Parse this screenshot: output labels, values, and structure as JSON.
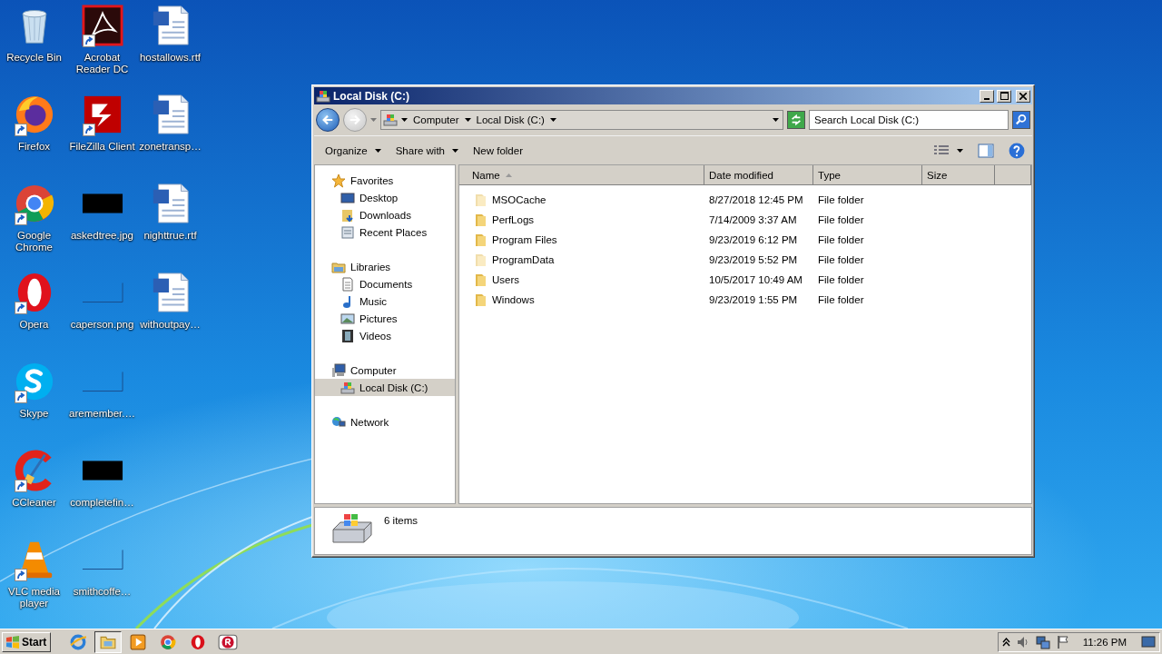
{
  "desktop_icons": [
    {
      "label": "Recycle Bin",
      "kind": "recycle-bin",
      "shortcut": false
    },
    {
      "label": "Firefox",
      "kind": "firefox",
      "shortcut": true
    },
    {
      "label": "Google Chrome",
      "kind": "chrome",
      "shortcut": true
    },
    {
      "label": "Opera",
      "kind": "opera",
      "shortcut": true
    },
    {
      "label": "Skype",
      "kind": "skype",
      "shortcut": true
    },
    {
      "label": "CCleaner",
      "kind": "ccleaner",
      "shortcut": true
    },
    {
      "label": "VLC media player",
      "kind": "vlc",
      "shortcut": true
    },
    {
      "label": "Acrobat Reader DC",
      "kind": "acrobat",
      "shortcut": true
    },
    {
      "label": "FileZilla Client",
      "kind": "filezilla",
      "shortcut": true
    },
    {
      "label": "askedtree.jpg",
      "kind": "image-black",
      "shortcut": false
    },
    {
      "label": "caperson.png",
      "kind": "image-blank",
      "shortcut": false
    },
    {
      "label": "aremember.…",
      "kind": "image-blank",
      "shortcut": false
    },
    {
      "label": "completefin…",
      "kind": "image-black",
      "shortcut": false
    },
    {
      "label": "smithcoffe…",
      "kind": "image-blank",
      "shortcut": false
    },
    {
      "label": "hostallows.rtf",
      "kind": "word-doc",
      "shortcut": false
    },
    {
      "label": "zonetransp…",
      "kind": "word-doc",
      "shortcut": false
    },
    {
      "label": "nighttrue.rtf",
      "kind": "word-doc",
      "shortcut": false
    },
    {
      "label": "withoutpay…",
      "kind": "word-doc",
      "shortcut": false
    }
  ],
  "window": {
    "title": "Local Disk (C:)",
    "breadcrumb": [
      "Computer",
      "Local Disk (C:)"
    ],
    "search": {
      "placeholder": "Search Local Disk (C:)"
    },
    "toolbar": [
      {
        "label": "Organize",
        "dropdown": true
      },
      {
        "label": "Share with",
        "dropdown": true
      },
      {
        "label": "New folder",
        "dropdown": false
      }
    ],
    "nav": [
      {
        "label": "Favorites",
        "kind": "favorites",
        "selected": false,
        "children": [
          {
            "label": "Desktop",
            "kind": "desktop",
            "selected": false
          },
          {
            "label": "Downloads",
            "kind": "downloads",
            "selected": false
          },
          {
            "label": "Recent Places",
            "kind": "recent",
            "selected": false
          }
        ]
      },
      {
        "label": "Libraries",
        "kind": "libraries",
        "selected": false,
        "children": [
          {
            "label": "Documents",
            "kind": "documents",
            "selected": false
          },
          {
            "label": "Music",
            "kind": "music",
            "selected": false
          },
          {
            "label": "Pictures",
            "kind": "pictures",
            "selected": false
          },
          {
            "label": "Videos",
            "kind": "videos",
            "selected": false
          }
        ]
      },
      {
        "label": "Computer",
        "kind": "computer",
        "selected": false,
        "children": [
          {
            "label": "Local Disk (C:)",
            "kind": "drive",
            "selected": true
          }
        ]
      },
      {
        "label": "Network",
        "kind": "network",
        "selected": false
      }
    ],
    "table": {
      "columns": [
        {
          "label": "Name",
          "sorted": true
        },
        {
          "label": "Date modified",
          "sorted": false
        },
        {
          "label": "Type",
          "sorted": false
        },
        {
          "label": "Size",
          "sorted": false
        }
      ],
      "rows": [
        {
          "name": "MSOCache",
          "date": "8/27/2018 12:45 PM",
          "type": "File folder",
          "hidden": true
        },
        {
          "name": "PerfLogs",
          "date": "7/14/2009 3:37 AM",
          "type": "File folder",
          "hidden": false
        },
        {
          "name": "Program Files",
          "date": "9/23/2019 6:12 PM",
          "type": "File folder",
          "hidden": false
        },
        {
          "name": "ProgramData",
          "date": "9/23/2019 5:52 PM",
          "type": "File folder",
          "hidden": true
        },
        {
          "name": "Users",
          "date": "10/5/2017 10:49 AM",
          "type": "File folder",
          "hidden": false
        },
        {
          "name": "Windows",
          "date": "9/23/2019 1:55 PM",
          "type": "File folder",
          "hidden": false
        }
      ]
    },
    "status": "6 items"
  },
  "taskbar": {
    "start": "Start",
    "apps": [
      {
        "kind": "ie",
        "active": false
      },
      {
        "kind": "explorer",
        "active": true
      },
      {
        "kind": "media",
        "active": false
      },
      {
        "kind": "chrome",
        "active": false
      },
      {
        "kind": "opera",
        "active": false
      },
      {
        "kind": "red-r",
        "active": false
      }
    ],
    "clock": "11:26 PM"
  }
}
